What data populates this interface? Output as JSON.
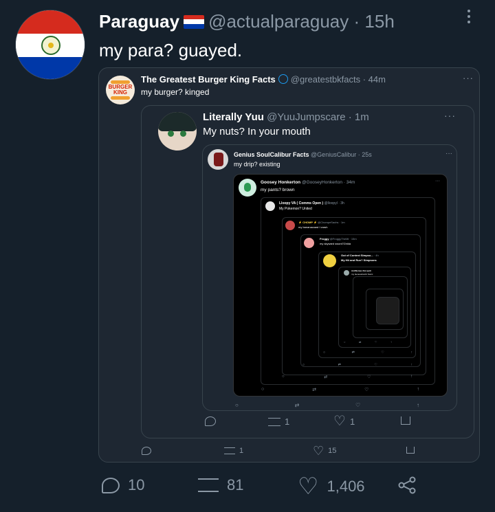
{
  "main": {
    "name": "Paraguay",
    "handle": "@actualparaguay",
    "time": "· 15h",
    "text": "my para? guayed.",
    "reply_count": "10",
    "retweet_count": "81",
    "like_count": "1,406",
    "flag_colors": [
      "#d52b1e",
      "#ffffff",
      "#0038a8"
    ]
  },
  "quote1": {
    "name": "The Greatest Burger King Facts",
    "handle": "@greatestbkfacts · 44m",
    "text": "my burger? kinged",
    "logo_text": [
      "BURGER",
      "KING"
    ],
    "retweets": "1",
    "likes": "15"
  },
  "quote2": {
    "name": "Literally Yuu",
    "handle": "@YuuJumpscare · 1m",
    "text": "My nuts? In your mouth",
    "retweets": "1",
    "likes": "1"
  },
  "quote3": {
    "name": "Genius SoulCalibur Facts",
    "handle": "@GeniusCalibur · 25s",
    "text": "my drip? existing"
  },
  "quote4": {
    "name": "Goosey Honkerton",
    "handle": "@GooseyHonkerton · 34m",
    "text": "my pants? brown"
  },
  "quote5": {
    "name": "Lloopy VA ( Comms Open )",
    "handle": "@lloopyl · 3h",
    "text": "My Pokemon? United"
  },
  "quote6": {
    "name": "⚡ CHOMP ⚡",
    "handle": "@ChompeSachs · 1m",
    "text": "my bananacoast I crash"
  },
  "quote7": {
    "name": "Froggy",
    "handle": "@FroggyTheMi · 15m",
    "text": "my skyward sword?Zelda"
  },
  "quote8": {
    "name": "Out of Context Simpso...",
    "handle": "· 4h",
    "text": "My Hit and Run? Simpsons"
  },
  "quote9": {
    "name": "AntiNomes Not quiti",
    "text": "my Genevebord1 Sonic"
  },
  "icons": {
    "reply": "reply-icon",
    "retweet": "retweet-icon",
    "like": "heart-icon",
    "share": "share-icon",
    "more": "more-icon",
    "verified": "globe-icon"
  },
  "accent": "#1d9bf0",
  "background": "#15202b"
}
